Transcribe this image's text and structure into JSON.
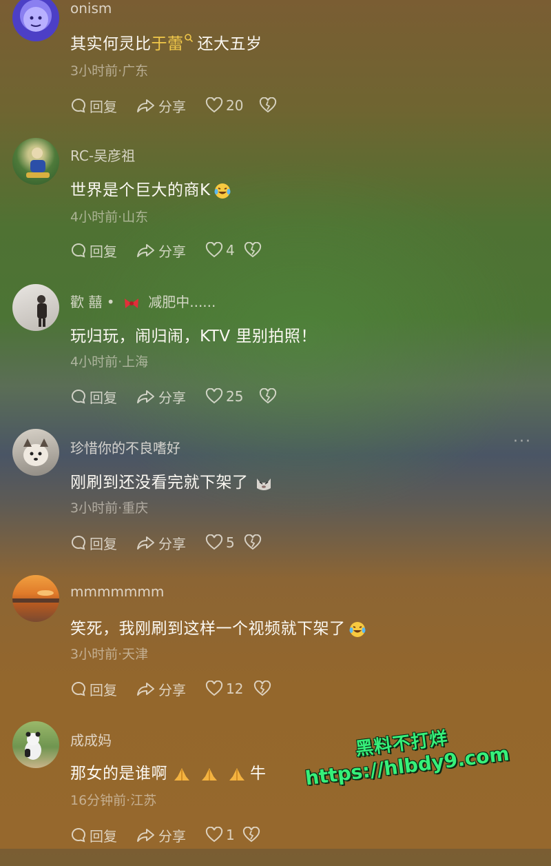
{
  "comments": [
    {
      "username": "onism",
      "text_before": "其实何灵比",
      "mention": "于蕾",
      "text_after": "还大五岁",
      "meta": "3小时前·广东",
      "reply_label": "回复",
      "share_label": "分享",
      "likes": "20"
    },
    {
      "username": "RC-吴彦祖",
      "text": "世界是个巨大的商K",
      "emoji": "laughing-tears-emoji",
      "meta": "4小时前·山东",
      "reply_label": "回复",
      "share_label": "分享",
      "likes": "4"
    },
    {
      "username": "歡 囍 •",
      "username_suffix": "减肥中......",
      "text": "玩归玩，闹归闹，KTV 里别拍照！",
      "meta": "4小时前·上海",
      "reply_label": "回复",
      "share_label": "分享",
      "likes": "25"
    },
    {
      "username": "珍惜你的不良嗜好",
      "text": "刚刷到还没看完就下架了",
      "emoji": "cat-emoji",
      "meta": "3小时前·重庆",
      "reply_label": "回复",
      "share_label": "分享",
      "likes": "5",
      "more": "···"
    },
    {
      "username": "mmmmmmm",
      "text": "笑死，我刚刷到这样一个视频就下架了",
      "emoji": "laughing-tears-emoji",
      "meta": "3小时前·天津",
      "reply_label": "回复",
      "share_label": "分享",
      "likes": "12"
    },
    {
      "username": "成成妈",
      "text_before": "那女的是谁啊",
      "text_after": "牛",
      "emoji": "praying-hands-emoji",
      "meta": "16分钟前·江苏",
      "reply_label": "回复",
      "share_label": "分享",
      "likes": "1"
    }
  ],
  "watermark": {
    "line1": "黑料不打烊",
    "line2": "https://hlbdy9.com"
  },
  "colors": {
    "mention": "#f1c84a",
    "watermark": "#36f07a"
  }
}
